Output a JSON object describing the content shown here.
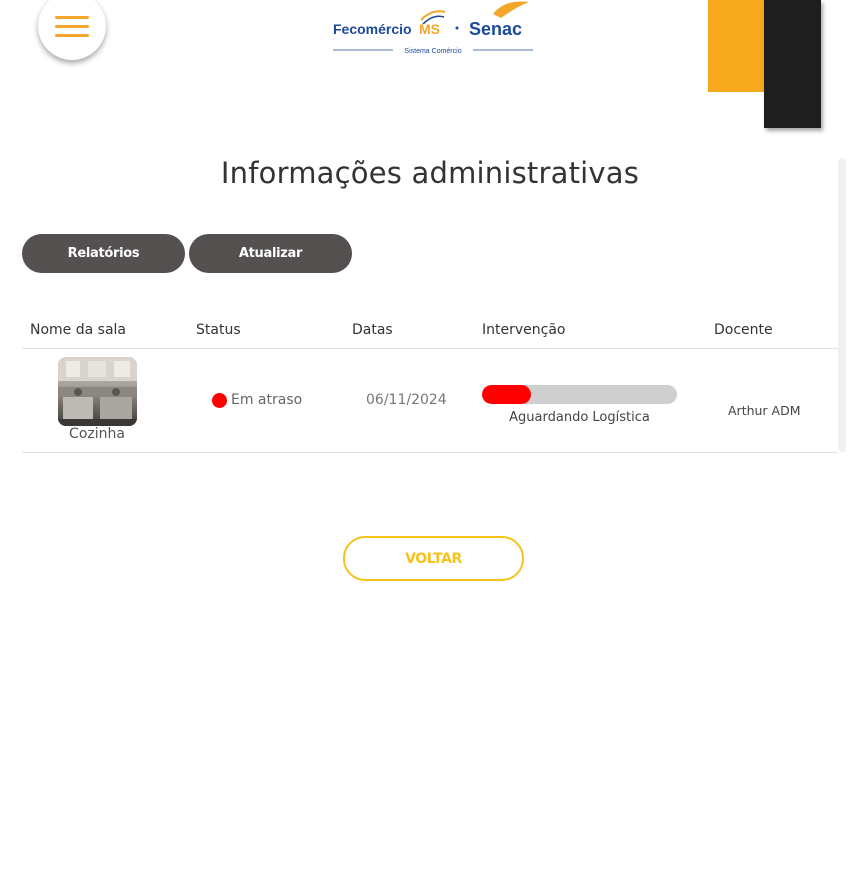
{
  "header": {
    "menu_icon": "hamburger-menu-icon",
    "logo": {
      "left_text": "Fecomércio",
      "left_accent": "MS",
      "right_text": "Senac",
      "tagline": "Sistema Comércio"
    },
    "accent_colors": {
      "orange": "#f6a91c",
      "dark": "#1e1e1e",
      "blue": "#1a4a99"
    }
  },
  "page_title": "Informações administrativas",
  "actions": {
    "reports_label": "Relatórios",
    "refresh_label": "Atualizar"
  },
  "table": {
    "columns": [
      "Nome da sala",
      "Status",
      "Datas",
      "Intervenção",
      "Docente"
    ],
    "rows": [
      {
        "room": "Cozinha",
        "photo_icon": "kitchen-photo",
        "status": "Em atraso",
        "status_color": "#ff0000",
        "date": "06/11/2024",
        "intervention_progress": 0.25,
        "intervention_label": "Aguardando Logística",
        "teacher": "Arthur ADM"
      }
    ]
  },
  "back_label": "VOLTAR",
  "back_color": "#f6c21c"
}
